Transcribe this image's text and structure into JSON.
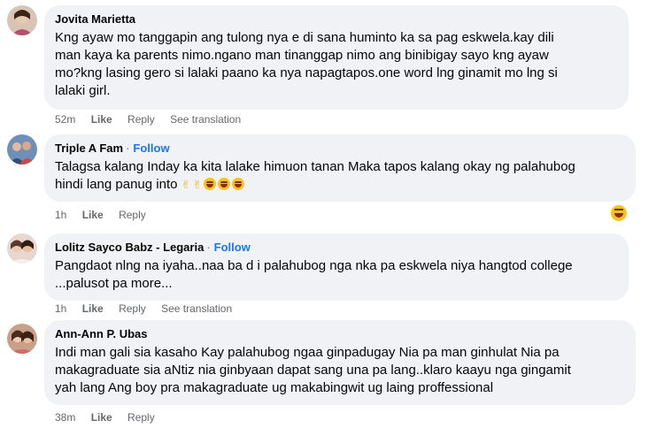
{
  "comments": [
    {
      "author": "Jovita Marietta",
      "follow": "",
      "lines": [
        "Kng ayaw mo tanggapin ang tulong nya e di sana huminto ka sa pag eskwela.kay dili",
        "man kaya ka parents nimo.ngano man tinanggap nimo ang binibigay sayo kng ayaw",
        "mo?kng lasing gero si lalaki paano ka nya napagtapos.one word lng ginamit mo lng si",
        "lalaki girl."
      ],
      "time": "52m",
      "like": "Like",
      "reply": "Reply",
      "translate": "See translation"
    },
    {
      "author": "Triple A Fam",
      "follow": "Follow",
      "lines": [
        "Talagsa kalang Inday ka kita lalake himuon tanan Maka tapos kalang okay ng palahubog",
        "hindi lang panug into"
      ],
      "time": "1h",
      "like": "Like",
      "reply": "Reply",
      "translate": ""
    },
    {
      "author": "Lolitz Sayco Babz - Legaria",
      "follow": "Follow",
      "lines": [
        "Pangdaot nlng na iyaha..naa ba d i palahubog nga nka pa eskwela niya hangtod college",
        "...palusot pa more..."
      ],
      "time": "1h",
      "like": "Like",
      "reply": "Reply",
      "translate": "See translation"
    },
    {
      "author": "Ann-Ann P. Ubas",
      "follow": "",
      "lines": [
        "Indi man gali sia kasaho Kay palahubog ngaa ginpadugay Nia pa man ginhulat Nia pa",
        "makagraduate sia aNtiz nia ginbyaan dapat sang una pa lang..klaro kaayu nga gingamit",
        "yah lang Ang boy pra makagraduate ug makabingwit ug laing proffessional"
      ],
      "time": "38m",
      "like": "Like",
      "reply": "Reply",
      "translate": ""
    }
  ],
  "colors": {
    "bubble": "#f0f2f5",
    "link": "#1877f2",
    "meta": "#65676b"
  }
}
